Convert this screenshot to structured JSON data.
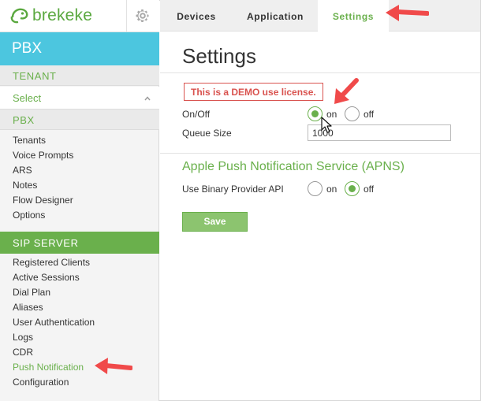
{
  "logo": {
    "text": "brekeke",
    "color": "#5aa83f"
  },
  "sidebar": {
    "header": "PBX",
    "tenant_section": "TENANT",
    "tenant_select": "Select",
    "pbx_section": "PBX",
    "pbx_items": [
      "Tenants",
      "Voice Prompts",
      "ARS",
      "Notes",
      "Flow Designer",
      "Options"
    ],
    "sip_section": "SIP SERVER",
    "sip_items": [
      "Registered Clients",
      "Active Sessions",
      "Dial Plan",
      "Aliases",
      "User Authentication",
      "Logs",
      "CDR",
      "Push Notification",
      "Configuration"
    ],
    "active_item": "Push Notification"
  },
  "tabs": [
    {
      "label": "Devices",
      "active": false
    },
    {
      "label": "Application",
      "active": false
    },
    {
      "label": "Settings",
      "active": true
    }
  ],
  "main": {
    "title": "Settings",
    "license_notice": "This is a DEMO use license.",
    "onoff": {
      "label": "On/Off",
      "on_label": "on",
      "off_label": "off",
      "selected": "on"
    },
    "queue_size": {
      "label": "Queue Size",
      "value": "1000"
    },
    "apns": {
      "title": "Apple Push Notification Service (APNS)",
      "binary_api": {
        "label": "Use Binary Provider API",
        "on_label": "on",
        "off_label": "off",
        "selected": "off"
      }
    },
    "save_label": "Save"
  },
  "colors": {
    "accent_green": "#6ab04c",
    "pbx_blue": "#4cc6df",
    "warning_red": "#d9534f",
    "annotation_arrow": "#f04a4a"
  }
}
